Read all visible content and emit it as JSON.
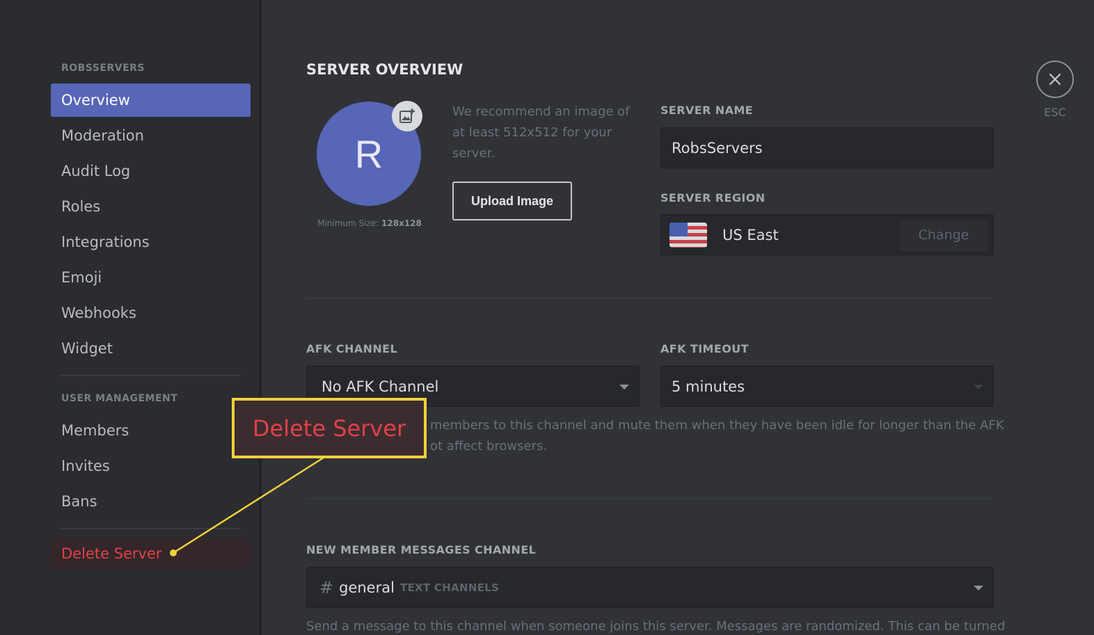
{
  "sidebar": {
    "server_heading": "ROBSSERVERS",
    "items": [
      {
        "label": "Overview"
      },
      {
        "label": "Moderation"
      },
      {
        "label": "Audit Log"
      },
      {
        "label": "Roles"
      },
      {
        "label": "Integrations"
      },
      {
        "label": "Emoji"
      },
      {
        "label": "Webhooks"
      },
      {
        "label": "Widget"
      }
    ],
    "user_mgmt_heading": "USER MANAGEMENT",
    "user_items": [
      {
        "label": "Members"
      },
      {
        "label": "Invites"
      },
      {
        "label": "Bans"
      }
    ],
    "delete_label": "Delete Server"
  },
  "main": {
    "title": "SERVER OVERVIEW",
    "avatar_letter": "R",
    "min_size_prefix": "Minimum Size: ",
    "min_size_value": "128x128",
    "recommend_text": "We recommend an image of at least 512x512 for your server.",
    "upload_label": "Upload Image",
    "server_name_label": "SERVER NAME",
    "server_name_value": "RobsServers",
    "server_region_label": "SERVER REGION",
    "server_region_value": "US East",
    "change_label": "Change",
    "afk_channel_label": "AFK CHANNEL",
    "afk_channel_value": "No AFK Channel",
    "afk_timeout_label": "AFK TIMEOUT",
    "afk_timeout_value": "5 minutes",
    "afk_help_line1": "members to this channel and mute them when they have been idle for longer than the AFK",
    "afk_help_line2": "ot affect browsers.",
    "new_member_label": "NEW MEMBER MESSAGES CHANNEL",
    "new_member_hash": "#",
    "new_member_channel": "general",
    "new_member_category": "TEXT CHANNELS",
    "new_member_help": "Send a message to this channel when someone joins this server. Messages are randomized. This can be turned"
  },
  "close": {
    "esc_label": "ESC"
  },
  "annotation": {
    "callout_text": "Delete Server"
  },
  "icons": [
    "add-image-icon",
    "close-icon",
    "us-flag-icon",
    "chevron-down-icon",
    "hash-icon"
  ],
  "colors": {
    "accent": "#5866b8",
    "danger": "#e0414a",
    "callout_border": "#f2d13a",
    "background": "#303237",
    "sidebar": "#2a2c30"
  }
}
